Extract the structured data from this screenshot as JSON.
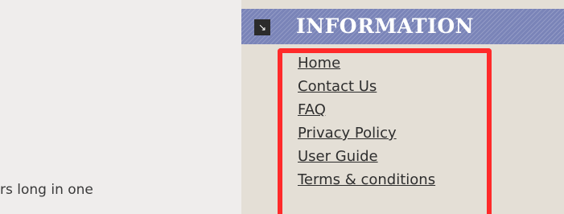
{
  "content": {
    "snippet_text": "rs long in one"
  },
  "sidebar": {
    "header": {
      "title": "INFORMATION",
      "icon_glyph": "↘",
      "icon": "arrow-down-right-icon"
    },
    "links": [
      {
        "label": "Home"
      },
      {
        "label": "Contact Us"
      },
      {
        "label": "FAQ"
      },
      {
        "label": "Privacy Policy"
      },
      {
        "label": "User Guide"
      },
      {
        "label": "Terms & conditions"
      }
    ]
  },
  "colors": {
    "header_bg": "#7a84b8",
    "sidebar_bg": "#e4dfd6",
    "highlight": "#ff2a2a"
  }
}
